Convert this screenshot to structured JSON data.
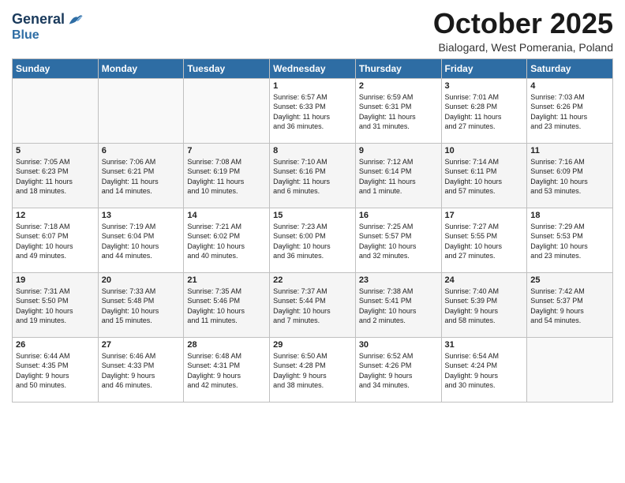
{
  "header": {
    "logo_line1": "General",
    "logo_line2": "Blue",
    "month": "October 2025",
    "location": "Bialogard, West Pomerania, Poland"
  },
  "weekdays": [
    "Sunday",
    "Monday",
    "Tuesday",
    "Wednesday",
    "Thursday",
    "Friday",
    "Saturday"
  ],
  "weeks": [
    [
      {
        "day": "",
        "info": ""
      },
      {
        "day": "",
        "info": ""
      },
      {
        "day": "",
        "info": ""
      },
      {
        "day": "1",
        "info": "Sunrise: 6:57 AM\nSunset: 6:33 PM\nDaylight: 11 hours\nand 36 minutes."
      },
      {
        "day": "2",
        "info": "Sunrise: 6:59 AM\nSunset: 6:31 PM\nDaylight: 11 hours\nand 31 minutes."
      },
      {
        "day": "3",
        "info": "Sunrise: 7:01 AM\nSunset: 6:28 PM\nDaylight: 11 hours\nand 27 minutes."
      },
      {
        "day": "4",
        "info": "Sunrise: 7:03 AM\nSunset: 6:26 PM\nDaylight: 11 hours\nand 23 minutes."
      }
    ],
    [
      {
        "day": "5",
        "info": "Sunrise: 7:05 AM\nSunset: 6:23 PM\nDaylight: 11 hours\nand 18 minutes."
      },
      {
        "day": "6",
        "info": "Sunrise: 7:06 AM\nSunset: 6:21 PM\nDaylight: 11 hours\nand 14 minutes."
      },
      {
        "day": "7",
        "info": "Sunrise: 7:08 AM\nSunset: 6:19 PM\nDaylight: 11 hours\nand 10 minutes."
      },
      {
        "day": "8",
        "info": "Sunrise: 7:10 AM\nSunset: 6:16 PM\nDaylight: 11 hours\nand 6 minutes."
      },
      {
        "day": "9",
        "info": "Sunrise: 7:12 AM\nSunset: 6:14 PM\nDaylight: 11 hours\nand 1 minute."
      },
      {
        "day": "10",
        "info": "Sunrise: 7:14 AM\nSunset: 6:11 PM\nDaylight: 10 hours\nand 57 minutes."
      },
      {
        "day": "11",
        "info": "Sunrise: 7:16 AM\nSunset: 6:09 PM\nDaylight: 10 hours\nand 53 minutes."
      }
    ],
    [
      {
        "day": "12",
        "info": "Sunrise: 7:18 AM\nSunset: 6:07 PM\nDaylight: 10 hours\nand 49 minutes."
      },
      {
        "day": "13",
        "info": "Sunrise: 7:19 AM\nSunset: 6:04 PM\nDaylight: 10 hours\nand 44 minutes."
      },
      {
        "day": "14",
        "info": "Sunrise: 7:21 AM\nSunset: 6:02 PM\nDaylight: 10 hours\nand 40 minutes."
      },
      {
        "day": "15",
        "info": "Sunrise: 7:23 AM\nSunset: 6:00 PM\nDaylight: 10 hours\nand 36 minutes."
      },
      {
        "day": "16",
        "info": "Sunrise: 7:25 AM\nSunset: 5:57 PM\nDaylight: 10 hours\nand 32 minutes."
      },
      {
        "day": "17",
        "info": "Sunrise: 7:27 AM\nSunset: 5:55 PM\nDaylight: 10 hours\nand 27 minutes."
      },
      {
        "day": "18",
        "info": "Sunrise: 7:29 AM\nSunset: 5:53 PM\nDaylight: 10 hours\nand 23 minutes."
      }
    ],
    [
      {
        "day": "19",
        "info": "Sunrise: 7:31 AM\nSunset: 5:50 PM\nDaylight: 10 hours\nand 19 minutes."
      },
      {
        "day": "20",
        "info": "Sunrise: 7:33 AM\nSunset: 5:48 PM\nDaylight: 10 hours\nand 15 minutes."
      },
      {
        "day": "21",
        "info": "Sunrise: 7:35 AM\nSunset: 5:46 PM\nDaylight: 10 hours\nand 11 minutes."
      },
      {
        "day": "22",
        "info": "Sunrise: 7:37 AM\nSunset: 5:44 PM\nDaylight: 10 hours\nand 7 minutes."
      },
      {
        "day": "23",
        "info": "Sunrise: 7:38 AM\nSunset: 5:41 PM\nDaylight: 10 hours\nand 2 minutes."
      },
      {
        "day": "24",
        "info": "Sunrise: 7:40 AM\nSunset: 5:39 PM\nDaylight: 9 hours\nand 58 minutes."
      },
      {
        "day": "25",
        "info": "Sunrise: 7:42 AM\nSunset: 5:37 PM\nDaylight: 9 hours\nand 54 minutes."
      }
    ],
    [
      {
        "day": "26",
        "info": "Sunrise: 6:44 AM\nSunset: 4:35 PM\nDaylight: 9 hours\nand 50 minutes."
      },
      {
        "day": "27",
        "info": "Sunrise: 6:46 AM\nSunset: 4:33 PM\nDaylight: 9 hours\nand 46 minutes."
      },
      {
        "day": "28",
        "info": "Sunrise: 6:48 AM\nSunset: 4:31 PM\nDaylight: 9 hours\nand 42 minutes."
      },
      {
        "day": "29",
        "info": "Sunrise: 6:50 AM\nSunset: 4:28 PM\nDaylight: 9 hours\nand 38 minutes."
      },
      {
        "day": "30",
        "info": "Sunrise: 6:52 AM\nSunset: 4:26 PM\nDaylight: 9 hours\nand 34 minutes."
      },
      {
        "day": "31",
        "info": "Sunrise: 6:54 AM\nSunset: 4:24 PM\nDaylight: 9 hours\nand 30 minutes."
      },
      {
        "day": "",
        "info": ""
      }
    ]
  ]
}
